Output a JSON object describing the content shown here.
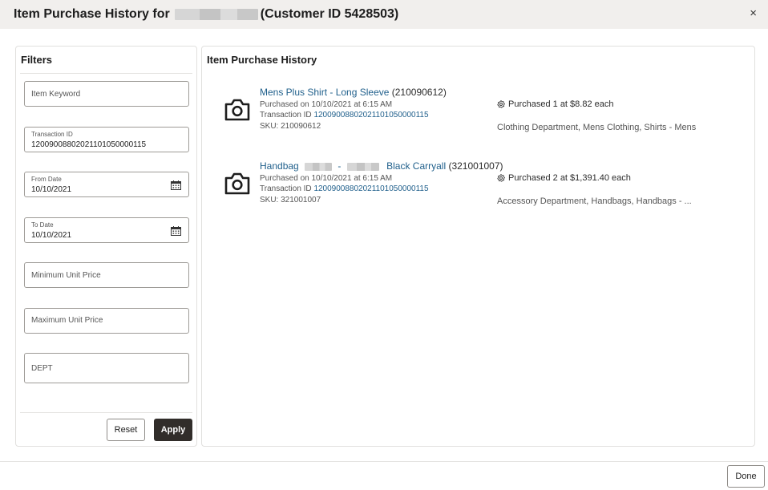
{
  "header": {
    "title_prefix": "Item Purchase History for",
    "title_suffix": "(Customer ID 5428503)",
    "close_glyph": "×"
  },
  "filters": {
    "title": "Filters",
    "item_keyword_placeholder": "Item Keyword",
    "transaction_id_label": "Transaction ID",
    "transaction_id_value": "12009008802021101050000115",
    "from_date_label": "From Date",
    "from_date_value": "10/10/2021",
    "to_date_label": "To Date",
    "to_date_value": "10/10/2021",
    "min_price_placeholder": "Minimum Unit Price",
    "max_price_placeholder": "Maximum Unit Price",
    "dept_placeholder": "DEPT",
    "reset_label": "Reset",
    "apply_label": "Apply"
  },
  "results": {
    "title": "Item Purchase History",
    "items": [
      {
        "name": "Mens Plus Shirt - Long Sleeve",
        "code": "(210090612)",
        "purchased_on": "Purchased on 10/10/2021 at 6:15 AM",
        "transaction_prefix": "Transaction ID",
        "transaction_id": "12009008802021101050000115",
        "sku": "SKU: 210090612",
        "purchased": "Purchased 1 at $8.82 each",
        "department": "Clothing Department, Mens Clothing, Shirts - Mens"
      },
      {
        "name_a": "Handbag",
        "name_sep": "-",
        "name_b": "Black Carryall",
        "code": "(321001007)",
        "purchased_on": "Purchased on 10/10/2021 at 6:15 AM",
        "transaction_prefix": "Transaction ID",
        "transaction_id": "12009008802021101050000115",
        "sku": "SKU: 321001007",
        "purchased": "Purchased 2 at $1,391.40 each",
        "department": "Accessory Department, Handbags, Handbags - ..."
      }
    ]
  },
  "footer": {
    "done_label": "Done"
  },
  "icons": {
    "close": "close-icon",
    "calendar": "calendar-icon",
    "camera": "camera-icon",
    "badge": "badge-icon"
  },
  "colors": {
    "link": "#1f5f8b",
    "apply_bg": "#312d2a",
    "header_bg": "#f1efed"
  }
}
